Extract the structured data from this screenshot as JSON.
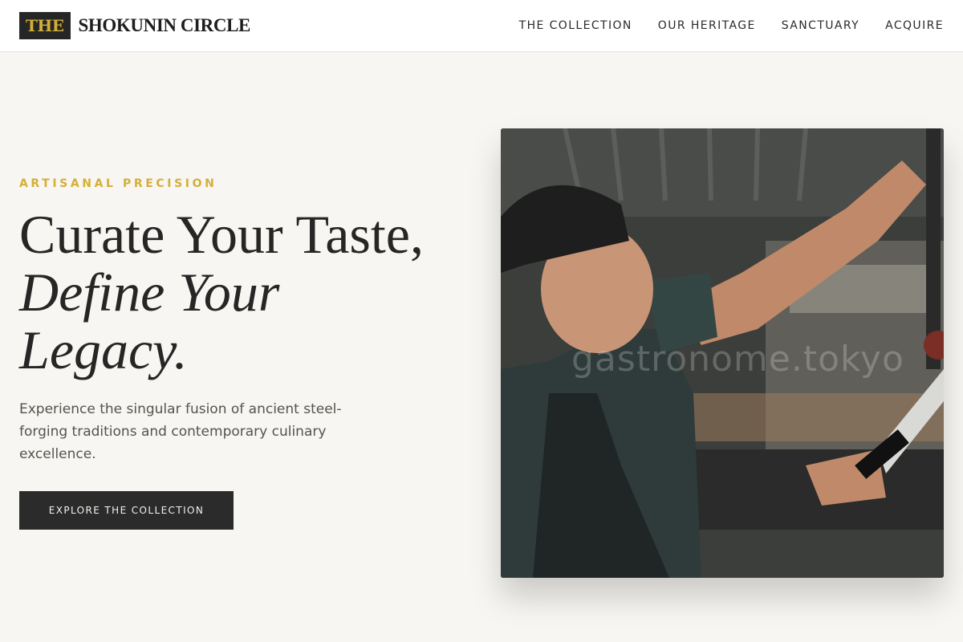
{
  "header": {
    "logo_mark": "THE",
    "logo_text": "SHOKUNIN CIRCLE",
    "nav": [
      {
        "label": "THE COLLECTION"
      },
      {
        "label": "OUR HERITAGE"
      },
      {
        "label": "SANCTUARY"
      },
      {
        "label": "ACQUIRE"
      }
    ]
  },
  "hero": {
    "eyebrow": "ARTISANAL PRECISION",
    "headline_line1": "Curate Your Taste,",
    "headline_line2": "Define Your",
    "headline_line3": "Legacy.",
    "lede": "Experience the singular fusion of ancient steel-forging traditions and contemporary culinary excellence.",
    "cta_label": "EXPLORE THE COLLECTION",
    "photo": {
      "watermark": "gastronome.tokyo"
    }
  },
  "colors": {
    "accent": "#d4af37",
    "dark": "#2b2b2b",
    "background": "#f7f6f2"
  }
}
